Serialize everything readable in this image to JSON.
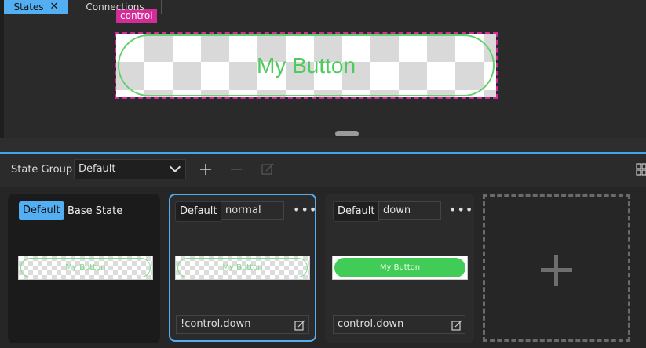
{
  "canvas": {
    "control_tag": "control",
    "button_text": "My Button"
  },
  "tabs": [
    {
      "label": "States"
    },
    {
      "label": "Connections"
    }
  ],
  "toolbar": {
    "state_group_label": "State Group",
    "state_group_value": "Default"
  },
  "states": [
    {
      "badge": "Default",
      "name": "Base State",
      "preview_text": "My Button",
      "condition": ""
    },
    {
      "badge": "Default",
      "name": "normal",
      "preview_text": "My Button",
      "condition": "!control.down"
    },
    {
      "badge": "Default",
      "name": "down",
      "preview_text": "My Button",
      "condition": "control.down"
    }
  ],
  "colors": {
    "selection": "#d42d9a",
    "accent": "#54aef2",
    "button_green": "#41cc57"
  }
}
